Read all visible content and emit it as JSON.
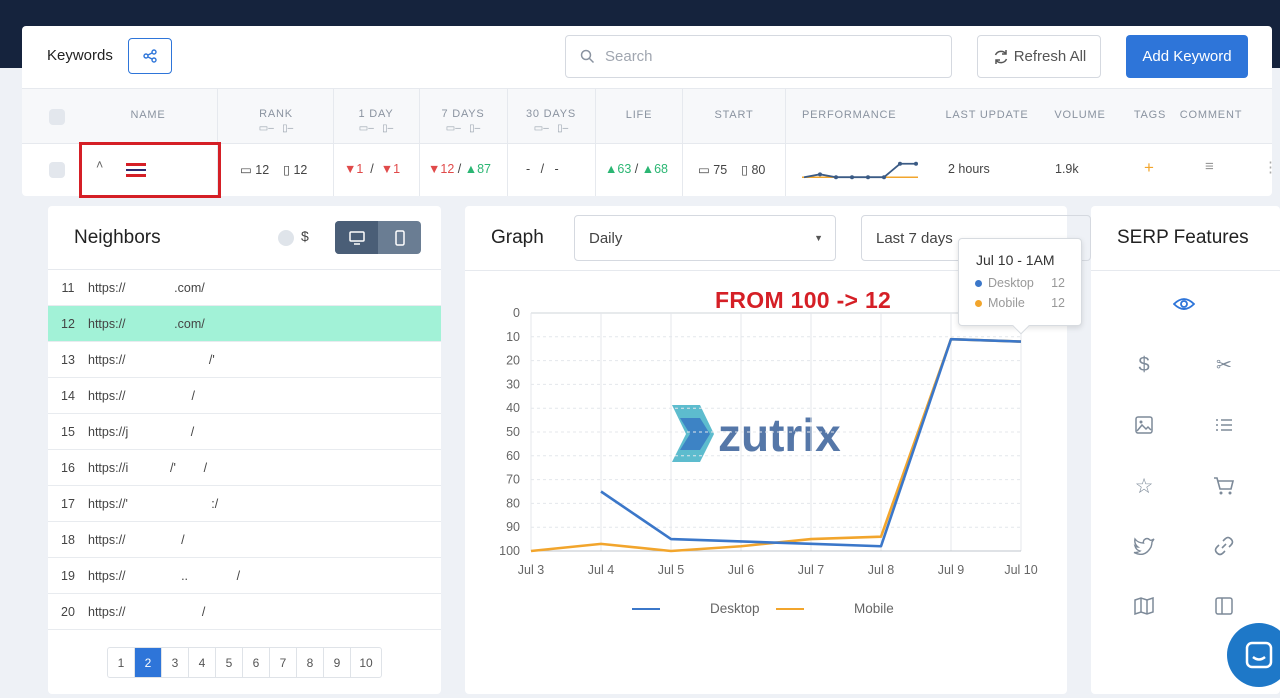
{
  "keywords": {
    "title": "Keywords",
    "search_placeholder": "Search",
    "refresh_label": "Refresh All",
    "add_label": "Add Keyword",
    "columns": {
      "name": "NAME",
      "rank": "RANK",
      "day1": "1 DAY",
      "days7": "7 DAYS",
      "days30": "30 DAYS",
      "life": "LIFE",
      "start": "START",
      "performance": "PERFORMANCE",
      "last_update": "LAST UPDATE",
      "volume": "VOLUME",
      "tags": "TAGS",
      "comment": "COMMENT"
    },
    "device_dash": "–",
    "row": {
      "rank_desktop": "12",
      "rank_mobile": "12",
      "day1_desktop": "▼1",
      "day1_mobile": "▼1",
      "days7_desktop": "▼12",
      "days7_mobile": "▲87",
      "days30_desktop": "-",
      "days30_mobile": "-",
      "life_desktop": "▲63",
      "life_mobile": "▲68",
      "start_desktop": "75",
      "start_mobile": "80",
      "last_update": "2 hours",
      "volume": "1.9k",
      "tags": "+",
      "separator": "/",
      "performance_spark": [
        100,
        97,
        100,
        100,
        100,
        100,
        86,
        86
      ]
    }
  },
  "neighbors": {
    "title": "Neighbors",
    "currency": "$",
    "rows": [
      {
        "num": "11",
        "url": "https://              .com/"
      },
      {
        "num": "12",
        "url": "https://              .com/"
      },
      {
        "num": "13",
        "url": "https://                        /'"
      },
      {
        "num": "14",
        "url": "https://                   /"
      },
      {
        "num": "15",
        "url": "https://j                  /"
      },
      {
        "num": "16",
        "url": "https://i            /'        /"
      },
      {
        "num": "17",
        "url": "https://'                        :/"
      },
      {
        "num": "18",
        "url": "https://                /"
      },
      {
        "num": "19",
        "url": "https://                ..              /"
      },
      {
        "num": "20",
        "url": "https://                      /"
      }
    ],
    "highlight_index": 1,
    "pages": [
      "1",
      "2",
      "3",
      "4",
      "5",
      "6",
      "7",
      "8",
      "9",
      "10"
    ],
    "active_page": "2"
  },
  "graph": {
    "title": "Graph",
    "interval": "Daily",
    "range": "Last 7 days",
    "annotation": "FROM 100 -> 12",
    "watermark": "zutrix",
    "tooltip": {
      "title": "Jul 10 - 1AM",
      "desktop_label": "Desktop",
      "desktop_value": "12",
      "mobile_label": "Mobile",
      "mobile_value": "12"
    }
  },
  "serp": {
    "title": "SERP Features",
    "icons": [
      "eye-icon",
      "dollar-icon",
      "scissors-icon",
      "image-icon",
      "list-icon",
      "star-icon",
      "cart-icon",
      "twitter-icon",
      "link-icon",
      "map-icon",
      "panel-icon"
    ]
  },
  "colors": {
    "accent": "#2e75d9",
    "desktop": "#3b77c9",
    "mobile": "#f2a52c",
    "highlight": "#a2f2d7",
    "alert": "#d51f26"
  },
  "chart_data": {
    "type": "line",
    "categories": [
      "Jul 3",
      "Jul 4",
      "Jul 5",
      "Jul 6",
      "Jul 7",
      "Jul 8",
      "Jul 9",
      "Jul 10"
    ],
    "series": [
      {
        "name": "Desktop",
        "values": [
          null,
          75,
          95,
          96,
          97,
          98,
          11,
          12
        ]
      },
      {
        "name": "Mobile",
        "values": [
          100,
          97,
          100,
          98,
          95,
          94,
          11,
          12
        ]
      }
    ],
    "y_ticks": [
      "0",
      "10",
      "20",
      "30",
      "40",
      "50",
      "60",
      "70",
      "80",
      "90",
      "100"
    ],
    "ylim": [
      0,
      100
    ],
    "y_inverted": true,
    "grid": true,
    "legend": "bottom"
  }
}
